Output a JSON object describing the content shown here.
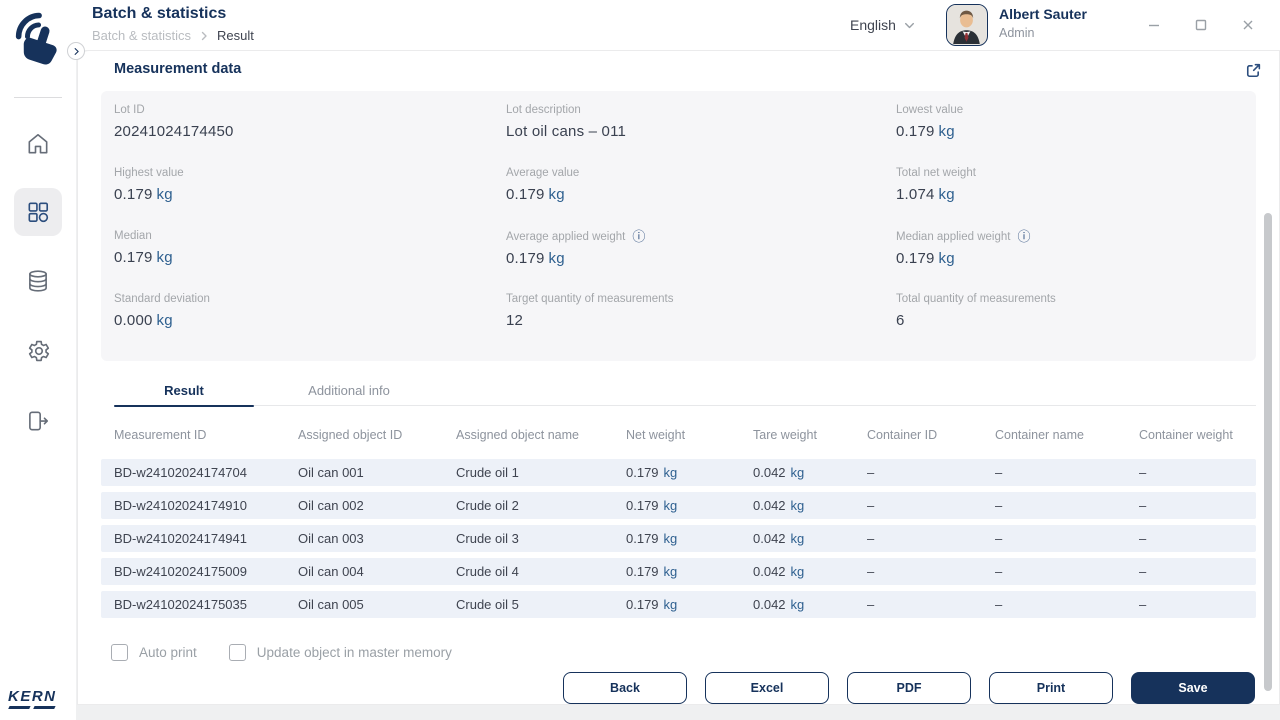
{
  "header": {
    "title": "Batch & statistics",
    "breadcrumb": {
      "parent": "Batch & statistics",
      "current": "Result"
    },
    "language": {
      "label": "English"
    },
    "user": {
      "name": "Albert Sauter",
      "role": "Admin"
    }
  },
  "sidebar": {
    "brand": "KERN",
    "items": [
      {
        "name": "home",
        "active": false
      },
      {
        "name": "apps",
        "active": true
      },
      {
        "name": "database",
        "active": false
      },
      {
        "name": "settings",
        "active": false
      },
      {
        "name": "logout",
        "active": false
      }
    ]
  },
  "panel": {
    "title": "Measurement data",
    "stats": [
      {
        "label": "Lot ID",
        "value": "20241024174450",
        "unit": ""
      },
      {
        "label": "Lot description",
        "value": "Lot oil cans – 011",
        "unit": ""
      },
      {
        "label": "Lowest value",
        "value": "0.179",
        "unit": "kg"
      },
      {
        "label": "Highest value",
        "value": "0.179",
        "unit": "kg"
      },
      {
        "label": "Average value",
        "value": "0.179",
        "unit": "kg"
      },
      {
        "label": "Total net weight",
        "value": "1.074",
        "unit": "kg"
      },
      {
        "label": "Median",
        "value": "0.179",
        "unit": "kg"
      },
      {
        "label": "Average applied weight",
        "value": "0.179",
        "unit": "kg",
        "info": true
      },
      {
        "label": "Median applied weight",
        "value": "0.179",
        "unit": "kg",
        "info": true
      },
      {
        "label": "Standard deviation",
        "value": "0.000",
        "unit": "kg"
      },
      {
        "label": "Target quantity of measurements",
        "value": "12",
        "unit": ""
      },
      {
        "label": "Total quantity of measurements",
        "value": "6",
        "unit": ""
      }
    ],
    "tabs": [
      {
        "label": "Result",
        "active": true
      },
      {
        "label": "Additional info",
        "active": false
      }
    ],
    "table": {
      "columns": [
        "Measurement ID",
        "Assigned object ID",
        "Assigned object name",
        "Net weight",
        "Tare weight",
        "Container ID",
        "Container name",
        "Container weight"
      ],
      "rows": [
        [
          "BD-w24102024174704",
          "Oil can 001",
          "Crude oil 1",
          "0.179 kg",
          "0.042 kg",
          "–",
          "–",
          "–"
        ],
        [
          "BD-w24102024174910",
          "Oil can 002",
          "Crude oil 2",
          "0.179 kg",
          "0.042 kg",
          "–",
          "–",
          "–"
        ],
        [
          "BD-w24102024174941",
          "Oil can 003",
          "Crude oil 3",
          "0.179 kg",
          "0.042 kg",
          "–",
          "–",
          "–"
        ],
        [
          "BD-w24102024175009",
          "Oil can 004",
          "Crude oil 4",
          "0.179 kg",
          "0.042 kg",
          "–",
          "–",
          "–"
        ],
        [
          "BD-w24102024175035",
          "Oil can 005",
          "Crude oil 5",
          "0.179 kg",
          "0.042 kg",
          "–",
          "–",
          "–"
        ]
      ]
    },
    "checkboxes": [
      {
        "label": "Auto print",
        "checked": false
      },
      {
        "label": "Update object in master memory",
        "checked": false
      }
    ],
    "buttons": [
      {
        "label": "Back",
        "primary": false
      },
      {
        "label": "Excel",
        "primary": false
      },
      {
        "label": "PDF",
        "primary": false
      },
      {
        "label": "Print",
        "primary": false
      },
      {
        "label": "Save",
        "primary": true
      }
    ]
  },
  "colors": {
    "accent": "#16325b",
    "unit_blue": "#2d5f8f",
    "row_background": "#edf1f8"
  }
}
